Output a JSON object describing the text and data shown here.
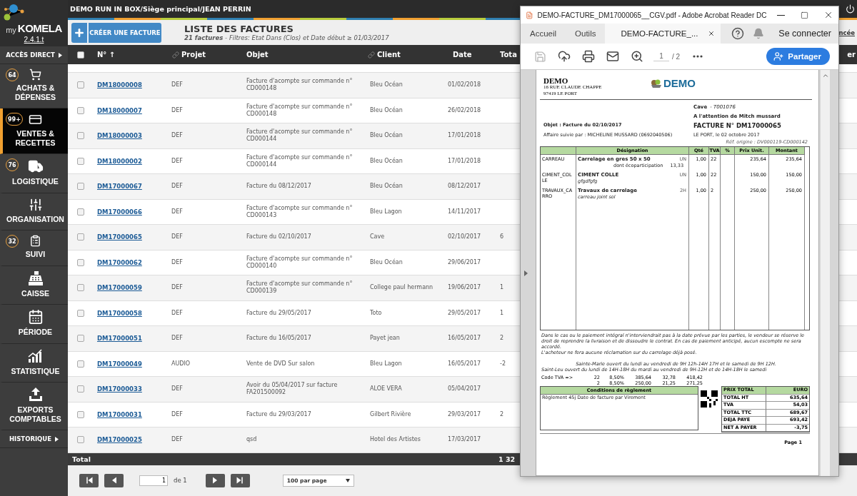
{
  "app": {
    "logo_prefix": "my",
    "logo": "KOMELA",
    "version": "2.4.1.t",
    "breadcrumb": "DEMO RUN IN BOX/Siège principal/JEAN PERRIN"
  },
  "sidebar": {
    "direct_access": "ACCÈS DIRECT",
    "history": "HISTORIQUE",
    "items": [
      {
        "kind": "cart",
        "label": "ACHATS & DÉPENSES",
        "badge": "64",
        "selected": false
      },
      {
        "kind": "card",
        "label": "VENTES & RECETTES",
        "badge": "99+",
        "selected": true
      },
      {
        "kind": "truck",
        "label": "LOGISTIQUE",
        "badge": "76",
        "selected": false
      },
      {
        "kind": "sliders",
        "label": "ORGANISATION",
        "selected": false
      },
      {
        "kind": "clipboard",
        "label": "SUIVI",
        "badge": "32",
        "selected": false
      },
      {
        "kind": "register",
        "label": "CAISSE",
        "selected": false
      },
      {
        "kind": "calendar",
        "label": "PÉRIODE",
        "selected": false
      },
      {
        "kind": "stats",
        "label": "STATISTIQUE",
        "selected": false
      },
      {
        "kind": "export",
        "label": "EXPORTS COMPTABLES",
        "selected": false
      }
    ]
  },
  "page": {
    "create_button": "CRÉER UNE FACTURE",
    "title": "LISTE DES FACTURES",
    "subtitle": "**21 factures** - Filtres: Etat Dans (Clos) et Date début ≥ 01/03/2017",
    "right_link": "ncée"
  },
  "table": {
    "header_checked": false,
    "right_label": "er",
    "columns": [
      {
        "label": "N° ↑",
        "kind": "plain"
      },
      {
        "label": "Projet",
        "kind": "linked"
      },
      {
        "label": "Objet",
        "kind": "plain"
      },
      {
        "label": "Client",
        "kind": "linked"
      },
      {
        "label": "Date",
        "kind": "plain"
      },
      {
        "label": "Tota",
        "kind": "plain"
      }
    ],
    "rows": [
      {
        "checked": false,
        "number": "DM18000008",
        "project": "DEF",
        "object": "Facture d'acompte sur commande n° CD000148",
        "client": "Bleu Océan",
        "date": "01/02/2018"
      },
      {
        "checked": false,
        "number": "DM18000007",
        "project": "DEF",
        "object": "Facture d'acompte sur commande n° CD000148",
        "client": "Bleu Océan",
        "date": "26/02/2018"
      },
      {
        "checked": false,
        "number": "DM18000003",
        "project": "DEF",
        "object": "Facture d'acompte sur commande n° CD000144",
        "client": "Bleu Océan",
        "date": "17/01/2018"
      },
      {
        "checked": false,
        "number": "DM18000002",
        "project": "DEF",
        "object": "Facture d'acompte sur commande n° CD000144",
        "client": "Bleu Océan",
        "date": "17/01/2018"
      },
      {
        "checked": false,
        "number": "DM17000067",
        "project": "DEF",
        "object": "Facture du 08/12/2017",
        "client": "Bleu Océan",
        "date": "08/12/2017"
      },
      {
        "checked": false,
        "number": "DM17000066",
        "project": "DEF",
        "object": "Facture d'acompte sur commande n° CD000143",
        "client": "Bleu Lagon",
        "date": "14/11/2017"
      },
      {
        "checked": false,
        "number": "DM17000065",
        "project": "DEF",
        "object": "Facture du 02/10/2017",
        "client": "Cave",
        "date": "02/10/2017",
        "total": "6"
      },
      {
        "checked": false,
        "number": "DM17000062",
        "project": "DEF",
        "object": "Facture d'acompte sur commande n° CD000140",
        "client": "Bleu Océan",
        "date": "29/06/2017"
      },
      {
        "checked": false,
        "number": "DM17000059",
        "project": "DEF",
        "object": "Facture d'acompte sur commande n° CD000139",
        "client": "College paul hermann",
        "date": "19/06/2017",
        "total": "1"
      },
      {
        "checked": false,
        "number": "DM17000058",
        "project": "DEF",
        "object": "Facture du 29/05/2017",
        "client": "Toto",
        "date": "29/05/2017",
        "total": "1"
      },
      {
        "checked": false,
        "number": "DM17000051",
        "project": "DEF",
        "object": "Facture du 16/05/2017",
        "client": "Payet jean",
        "date": "16/05/2017",
        "total": "2"
      },
      {
        "checked": false,
        "number": "DM17000049",
        "project": "AUDIO",
        "object": "Vente de DVD Sur salon",
        "client": "Bleu Lagon",
        "date": "16/05/2017",
        "total": "-2"
      },
      {
        "checked": false,
        "number": "DM17000033",
        "project": "DEF",
        "object": "Avoir du 05/04/2017 sur facture FA201500092",
        "client": "ALOE VERA",
        "date": "05/04/2017"
      },
      {
        "checked": false,
        "number": "DM17000031",
        "project": "DEF",
        "object": "Facture du 29/03/2017",
        "client": "Gilbert Rivière",
        "date": "29/03/2017",
        "total": "2"
      },
      {
        "checked": false,
        "number": "DM17000025",
        "project": "DEF",
        "object": "qsd",
        "client": "Hotel des Artistes",
        "date": "17/03/2017"
      }
    ],
    "footer": {
      "label": "Total",
      "value": "1 32"
    }
  },
  "pagination": {
    "page": "1",
    "of": "de 1",
    "per_page": "100 par page"
  },
  "pdf_window": {
    "title": "DEMO-FACTURE_DM17000065__CGV.pdf - Adobe Acrobat Reader DC",
    "tabs": [
      {
        "label": "Accueil",
        "selected": false
      },
      {
        "label": "Outils",
        "selected": false
      },
      {
        "label": "DEMO-FACTURE_...",
        "selected": true
      }
    ],
    "sign_in": "Se connecter",
    "page": "1",
    "page_total": "/ 2",
    "share": "Partager",
    "document": {
      "company": "DEMO",
      "address": [
        "16 RUE CLAUDE CHAPPE",
        "97419 LE PORT"
      ],
      "logo": "DEMO",
      "client": "Cave",
      "client_code": "- T001076",
      "attention": "A l'attention de Mitch mussard",
      "subject": "Objet : Facture du 02/10/2017",
      "invoice_number": "FACTURE N° DM17000065",
      "followed_by": "Affaire suivie par : MICHELINE MUSSARD (0692040506)",
      "place_date": "LE PORT, le 02 octobre 2017",
      "origin": "Réf. origine : DV000119-CD000142",
      "columns": [
        "Désignation",
        "Qté",
        "TVA",
        "%",
        "Prix Unit.",
        "Montant"
      ],
      "lines": [
        {
          "code": "CARREAU",
          "title": "Carrelage en gres 50 x 50",
          "note": "dont écoparticipation",
          "note_value": "13,33",
          "unit": "UN",
          "qty": "1,00",
          "vat": "22",
          "unit_price": "235,64",
          "amount": "235,64"
        },
        {
          "code": "CIMENT_COLLE",
          "title": "CIMENT COLLE",
          "sub": "gfgdfgfg",
          "unit": "UN",
          "qty": "1,00",
          "vat": "22",
          "unit_price": "150,00",
          "amount": "150,00"
        },
        {
          "code": "TRAVAUX_CARRO",
          "title": "Travaux de carrelage",
          "sub": "carreau joint sol",
          "unit": "2H",
          "qty": "1,00",
          "vat": "2",
          "unit_price": "250,00",
          "amount": "250,00"
        }
      ],
      "terms": [
        "Dans le cas ou le paiement intégral n'interviendrait pas à la date prévue par les parties, le vendeur se réserve le droit de reprendre la livraison et de dissoudre le contrat. En cas de paiement anticipé, aucun escompte ne sera accordé.",
        "L'acheteur ne fera aucune réclamation sur du carrelage déjà posé."
      ],
      "hours": [
        "Sainte-Marie ouvert du lundi au vendredi de 9H 12h-14H 17H et le samedi de 9H 12H.",
        "Saint-Leu ouvert du lundi de 14H-18H du mardi au vendredi de 9H-12H et de 14H-18H le samedi"
      ],
      "vat_label": "Code TVA =>",
      "vat_rows": [
        [
          "22",
          "8,50%",
          "385,64",
          "32,78",
          "418,42"
        ],
        [
          "2",
          "8,50%",
          "250,00",
          "21,25",
          "271,25"
        ]
      ],
      "conditions_title": "Conditions de règlement",
      "conditions": "Règlement 45j Date de facture par Virement",
      "totals_header": [
        "PRIX TOTAL",
        "EURO"
      ],
      "totals": [
        [
          "TOTAL HT",
          "635,64"
        ],
        [
          "TVA",
          "54,03"
        ],
        [
          "TOTAL TTC",
          "689,67"
        ],
        [
          "DEJA PAYE",
          "693,42"
        ],
        [
          "NET A PAYER",
          "-3,75"
        ]
      ],
      "page_label": "Page 1"
    }
  }
}
